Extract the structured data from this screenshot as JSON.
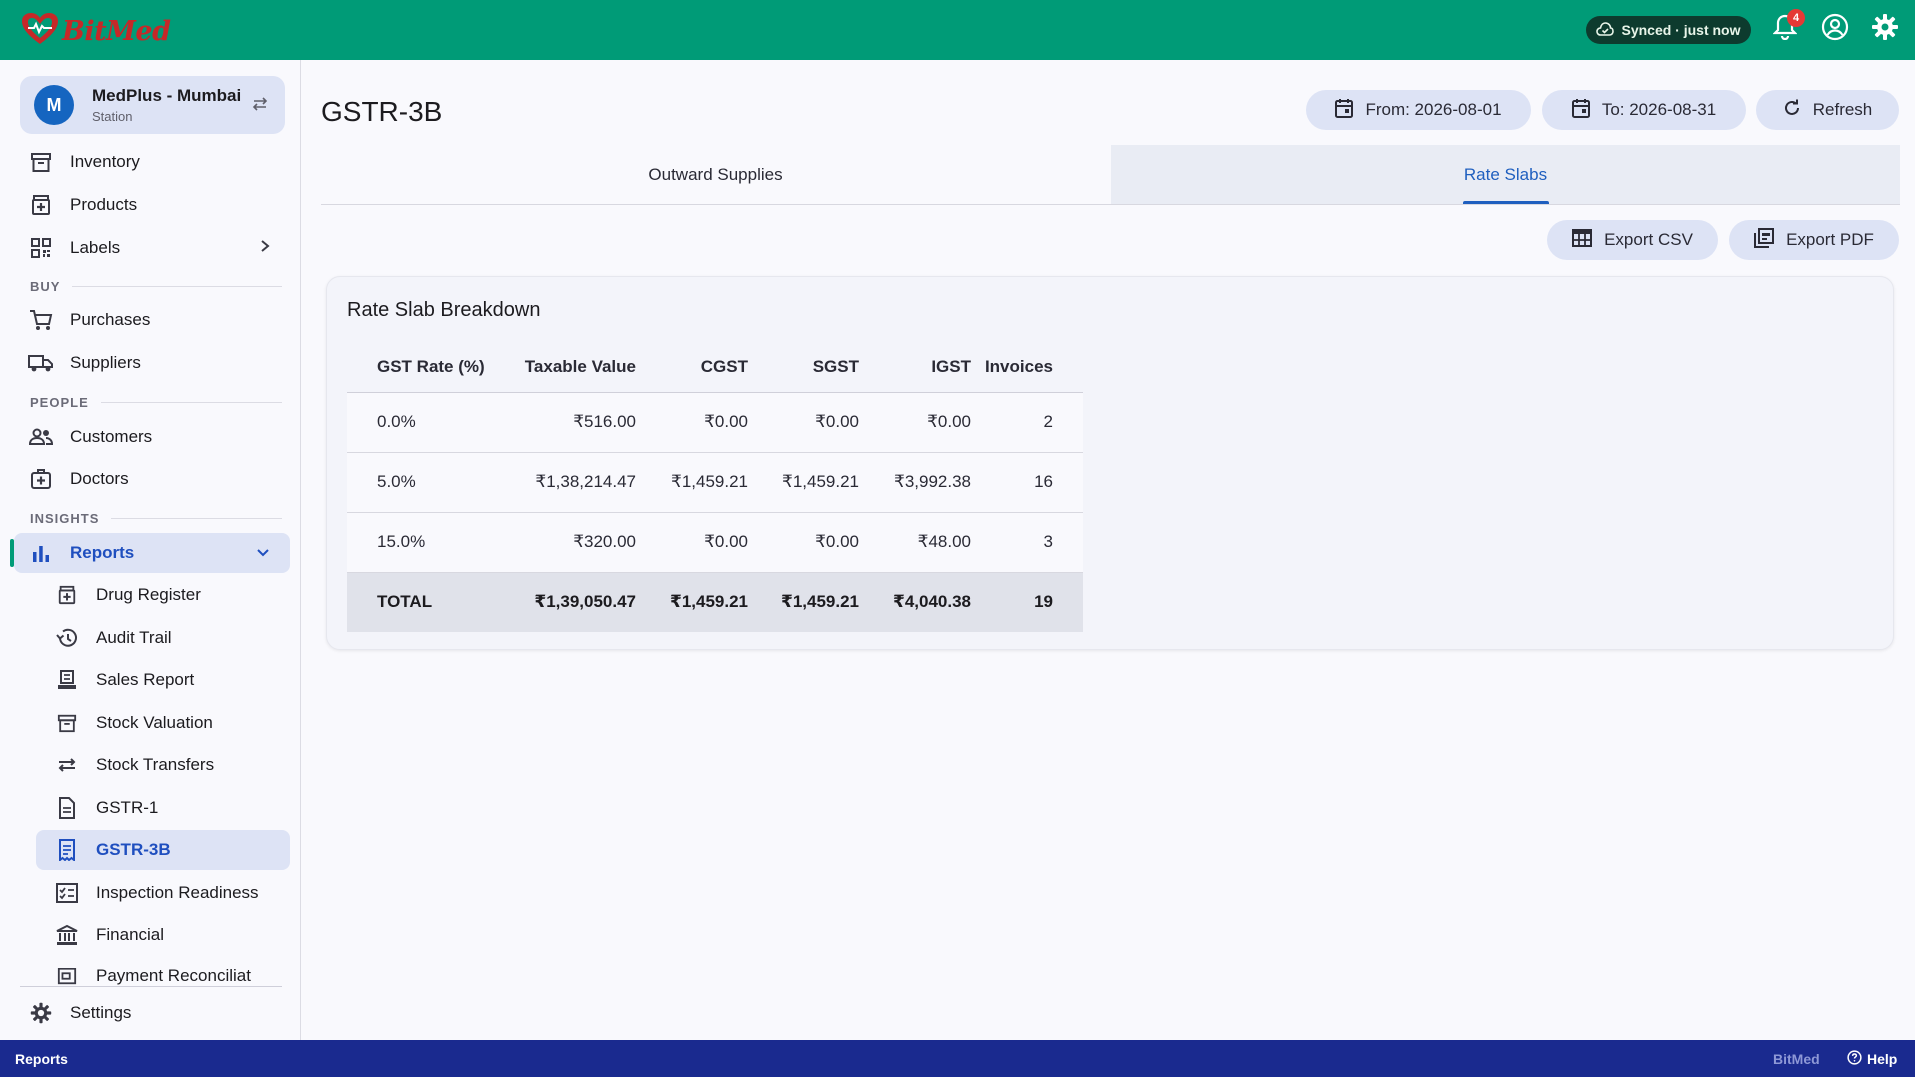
{
  "app": {
    "name": "BitMed"
  },
  "topbar": {
    "sync_status": "Synced · just now",
    "notification_count": "4"
  },
  "station": {
    "initial": "M",
    "name": "MedPlus - Mumbai",
    "role": "Station"
  },
  "sidebar": {
    "top_items": [
      {
        "label": "Inventory",
        "icon": "archive-box-icon"
      },
      {
        "label": "Products",
        "icon": "medical-box-icon"
      },
      {
        "label": "Labels",
        "icon": "qr-code-icon"
      }
    ],
    "sections": {
      "buy": "BUY",
      "people": "PEOPLE",
      "insights": "INSIGHTS"
    },
    "buy_items": [
      {
        "label": "Purchases",
        "icon": "cart-icon"
      },
      {
        "label": "Suppliers",
        "icon": "truck-icon"
      }
    ],
    "people_items": [
      {
        "label": "Customers",
        "icon": "people-icon"
      },
      {
        "label": "Doctors",
        "icon": "medical-bag-icon"
      }
    ],
    "reports": {
      "label": "Reports",
      "icon": "bar-chart-icon"
    },
    "report_items": [
      {
        "label": "Drug Register",
        "icon": "medical-box-icon"
      },
      {
        "label": "Audit Trail",
        "icon": "history-icon"
      },
      {
        "label": "Sales Report",
        "icon": "receipt-icon"
      },
      {
        "label": "Stock Valuation",
        "icon": "archive-box-icon"
      },
      {
        "label": "Stock Transfers",
        "icon": "swap-arrows-icon"
      },
      {
        "label": "GSTR-1",
        "icon": "document-icon"
      },
      {
        "label": "GSTR-3B",
        "icon": "receipt-long-icon"
      },
      {
        "label": "Inspection Readiness",
        "icon": "checklist-icon"
      },
      {
        "label": "Financial",
        "icon": "bank-icon"
      },
      {
        "label": "Payment Reconciliat",
        "icon": "payment-icon"
      }
    ],
    "settings": {
      "label": "Settings",
      "icon": "gear-icon"
    }
  },
  "page": {
    "title": "GSTR-3B",
    "from_label": "From: 2026-08-01",
    "to_label": "To: 2026-08-31",
    "refresh_label": "Refresh"
  },
  "tabs": [
    {
      "label": "Outward Supplies",
      "active": false
    },
    {
      "label": "Rate Slabs",
      "active": true
    }
  ],
  "actions": {
    "export_csv": "Export CSV",
    "export_pdf": "Export PDF"
  },
  "card": {
    "title": "Rate Slab Breakdown",
    "columns": [
      "GST Rate (%)",
      "Taxable Value",
      "CGST",
      "SGST",
      "IGST",
      "Invoices"
    ],
    "rows": [
      [
        "0.0%",
        "₹516.00",
        "₹0.00",
        "₹0.00",
        "₹0.00",
        "2"
      ],
      [
        "5.0%",
        "₹1,38,214.47",
        "₹1,459.21",
        "₹1,459.21",
        "₹3,992.38",
        "16"
      ],
      [
        "15.0%",
        "₹320.00",
        "₹0.00",
        "₹0.00",
        "₹48.00",
        "3"
      ]
    ],
    "total": [
      "TOTAL",
      "₹1,39,050.47",
      "₹1,459.21",
      "₹1,459.21",
      "₹4,040.38",
      "19"
    ]
  },
  "footer": {
    "section": "Reports",
    "brand": "BitMed",
    "help": "Help"
  },
  "colors": {
    "topbar": "#009b77",
    "footer": "#1a2a8f",
    "accent": "#1f5fbf",
    "logo": "#c62828"
  }
}
